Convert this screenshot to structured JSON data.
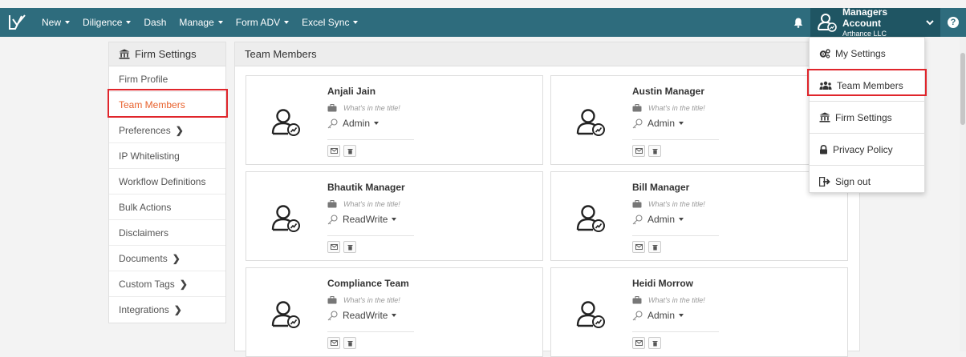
{
  "navbar": {
    "items": [
      {
        "label": "New",
        "dropdown": true
      },
      {
        "label": "Diligence",
        "dropdown": true
      },
      {
        "label": "Dash",
        "dropdown": false
      },
      {
        "label": "Manage",
        "dropdown": true
      },
      {
        "label": "Form ADV",
        "dropdown": true
      },
      {
        "label": "Excel Sync",
        "dropdown": true
      }
    ],
    "account_name": "Managers Account",
    "account_org": "Arthance LLC",
    "help": "?",
    "bg_color": "#2e6c7d"
  },
  "sidebar": {
    "heading": "Firm Settings",
    "items": [
      {
        "label": "Firm Profile"
      },
      {
        "label": "Team Members"
      },
      {
        "label": "Preferences"
      },
      {
        "label": "IP Whitelisting"
      },
      {
        "label": "Workflow Definitions"
      },
      {
        "label": "Bulk Actions"
      },
      {
        "label": "Disclaimers"
      },
      {
        "label": "Documents"
      },
      {
        "label": "Custom Tags"
      },
      {
        "label": "Integrations"
      }
    ],
    "active_index": 1,
    "active_color": "#e8612c"
  },
  "main": {
    "heading": "Team Members",
    "members": [
      {
        "name": "Anjali Jain",
        "title_placeholder": "What's in the title!",
        "role": "Admin"
      },
      {
        "name": "Austin Manager",
        "title_placeholder": "What's in the title!",
        "role": "Admin"
      },
      {
        "name": "Bhautik Manager",
        "title_placeholder": "What's in the title!",
        "role": "ReadWrite"
      },
      {
        "name": "Bill Manager",
        "title_placeholder": "What's in the title!",
        "role": "Admin"
      },
      {
        "name": "Compliance Team",
        "title_placeholder": "What's in the title!",
        "role": "ReadWrite"
      },
      {
        "name": "Heidi Morrow",
        "title_placeholder": "What's in the title!",
        "role": "Admin"
      }
    ]
  },
  "account_menu": {
    "items": [
      {
        "label": "My Settings",
        "icon": "cogs-icon"
      },
      {
        "label": "Team Members",
        "icon": "users-icon"
      },
      {
        "label": "Firm Settings",
        "icon": "bank-icon"
      },
      {
        "label": "Privacy Policy",
        "icon": "lock-icon"
      },
      {
        "label": "Sign out",
        "icon": "sign-out-icon"
      }
    ]
  },
  "highlight_color": "#e0252b"
}
